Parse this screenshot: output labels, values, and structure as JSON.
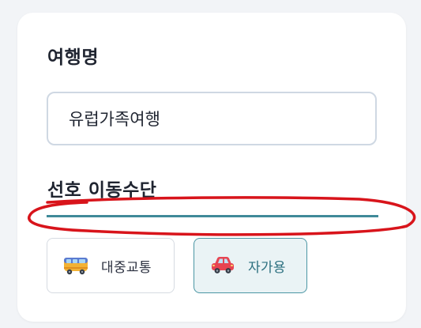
{
  "trip_name": {
    "label": "여행명",
    "value": "유럽가족여행"
  },
  "transport": {
    "label": "선호 이동수단",
    "options": [
      {
        "label": "대중교통",
        "icon": "bus-icon",
        "selected": false
      },
      {
        "label": "자가용",
        "icon": "car-icon",
        "selected": true
      }
    ]
  },
  "colors": {
    "accent": "#3f8a99",
    "selected_bg": "#eaf3f5",
    "annotation": "#d8141b"
  }
}
